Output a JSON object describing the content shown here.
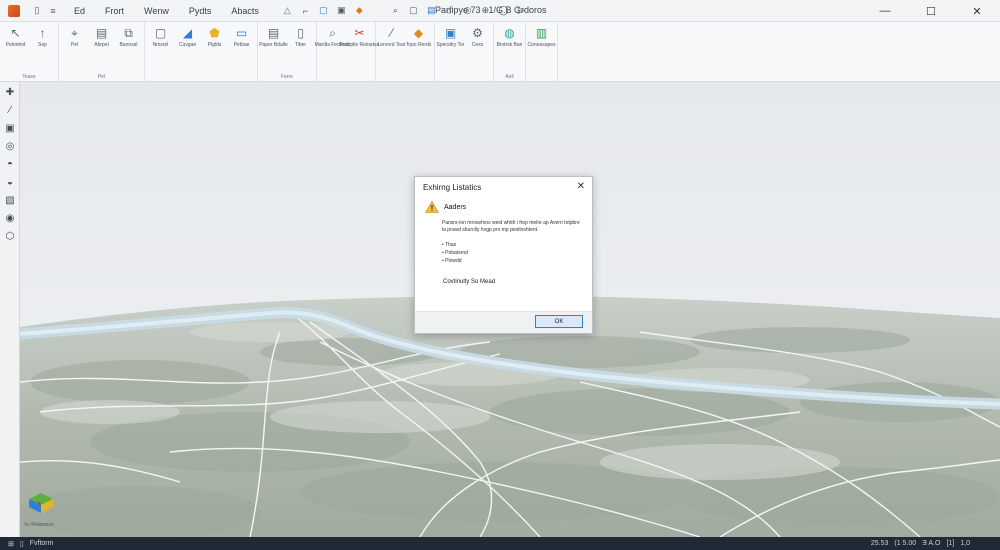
{
  "window": {
    "title": "Parfipye 73 - 1/G.B Grdoros",
    "menu": [
      "Ed",
      "Frort",
      "Wenw",
      "Pydts",
      "Abacts"
    ],
    "controls": [
      "—",
      "☐",
      "✕"
    ]
  },
  "ribbon": {
    "groups": [
      {
        "name": "Tease",
        "tools": [
          {
            "icon": "pointer",
            "glyph": "↖",
            "label": "Pelontnd",
            "color": "#5a6772"
          },
          {
            "icon": "arrow-up",
            "glyph": "↑",
            "label": "Sep",
            "color": "#5a6772"
          }
        ]
      },
      {
        "name": "Pet",
        "tools": [
          {
            "icon": "pin",
            "glyph": "⌖",
            "label": "Pel",
            "color": "#5a6772"
          },
          {
            "icon": "layers",
            "glyph": "▤",
            "label": "Abrpel",
            "color": "#5a6772"
          },
          {
            "icon": "copy",
            "glyph": "⧉",
            "label": "Bannsal",
            "color": "#5a6772"
          }
        ]
      },
      {
        "name": "",
        "tools": [
          {
            "icon": "square",
            "glyph": "▢",
            "label": "Nmsrel",
            "color": "#5a6772"
          },
          {
            "icon": "triangle",
            "glyph": "◢",
            "label": "Cuvgae",
            "color": "#2f7fd6"
          },
          {
            "icon": "polygon",
            "glyph": "⬟",
            "label": "Piglds",
            "color": "#e4b526"
          },
          {
            "icon": "panel",
            "glyph": "▭",
            "label": "Petbae",
            "color": "#2f7fd6"
          }
        ]
      },
      {
        "name": "Ferre",
        "tools": [
          {
            "icon": "document",
            "glyph": "▤",
            "label": "Paper Bdalle",
            "color": "#5a6772"
          },
          {
            "icon": "page",
            "glyph": "▯",
            "label": "Tiber",
            "color": "#5a6772"
          }
        ]
      },
      {
        "name": "",
        "tools": [
          {
            "icon": "zoom",
            "glyph": "⌕",
            "label": "Mardla Fedtenic",
            "color": "#5a6772"
          },
          {
            "icon": "cut",
            "glyph": "✂",
            "label": "Purbplie Reloates",
            "color": "#d83a2e"
          }
        ]
      },
      {
        "name": "",
        "tools": [
          {
            "icon": "wand",
            "glyph": "⁄",
            "label": "Lervord Tear",
            "color": "#5a6772"
          },
          {
            "icon": "palette",
            "glyph": "◆",
            "label": "Topo Rerds",
            "color": "#e58a2b"
          }
        ]
      },
      {
        "name": "",
        "tools": [
          {
            "icon": "view",
            "glyph": "▣",
            "label": "Spersltry Tor",
            "color": "#2f7fd6"
          },
          {
            "icon": "settings",
            "glyph": "⚙",
            "label": "Cexs",
            "color": "#5a6772"
          }
        ]
      },
      {
        "name": "Aoli",
        "tools": [
          {
            "icon": "globe",
            "glyph": "◍",
            "label": "Brvtrsk Ban",
            "color": "#2aa5a5"
          }
        ]
      },
      {
        "name": "",
        "tools": [
          {
            "icon": "bar-chart",
            "glyph": "▥",
            "label": "Ceneasapes",
            "color": "#3a9a55"
          }
        ]
      }
    ]
  },
  "left_tools": [
    "✚",
    "⁄",
    "▣",
    "◎",
    "◓",
    "◒",
    "▧",
    "◉",
    "⬡"
  ],
  "navcube": {
    "label": "Vo Relamnce"
  },
  "dialog": {
    "title": "Exhirng Listatics",
    "close": "✕",
    "heading": "Aaders",
    "message": "Pansrs-ion mrosefons weid whith i frep melre ap Avern totpbre la pnavd sburctly hvgp pro mp pestloshtent.",
    "items": [
      "Thas",
      "Pnbatsrnd",
      "Plowdd"
    ],
    "continue_text": "Covtinulty So Mead",
    "ok": "OK"
  },
  "statusbar": {
    "left": "Fvftorm",
    "right": [
      "25.53",
      "(1 5.00",
      "Ǝ A.O",
      "[1]",
      "1,0"
    ]
  }
}
